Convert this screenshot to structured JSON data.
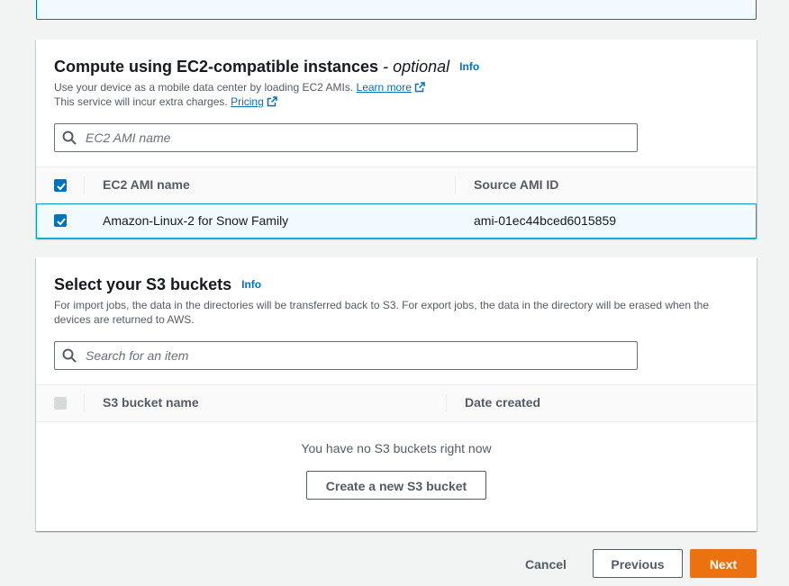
{
  "ec2": {
    "title": "Compute using EC2-compatible instances",
    "title_optional": "- optional",
    "info": "Info",
    "desc_line1": "Use your device as a mobile data center by loading EC2 AMIs.",
    "learn_more": "Learn more",
    "desc_line2": "This service will incur extra charges.",
    "pricing": "Pricing",
    "search_placeholder": "EC2 AMI name",
    "columns": [
      "EC2 AMI name",
      "Source AMI ID"
    ],
    "rows": [
      {
        "name": "Amazon-Linux-2 for Snow Family",
        "ami_id": "ami-01ec44bced6015859",
        "selected": true
      }
    ]
  },
  "s3": {
    "title": "Select your S3 buckets",
    "info": "Info",
    "description": "For import jobs, the data in the directories will be transferred back to S3. For export jobs, the data in the directory will be erased when the devices are returned to AWS.",
    "search_placeholder": "Search for an item",
    "columns": [
      "S3 bucket name",
      "Date created"
    ],
    "empty_text": "You have no S3 buckets right now",
    "create_button": "Create a new S3 bucket"
  },
  "footer": {
    "cancel": "Cancel",
    "previous": "Previous",
    "next": "Next"
  },
  "colors": {
    "accent": "#0073bb",
    "primary_button": "#ec7211",
    "selected_row_bg": "#f1faff"
  }
}
